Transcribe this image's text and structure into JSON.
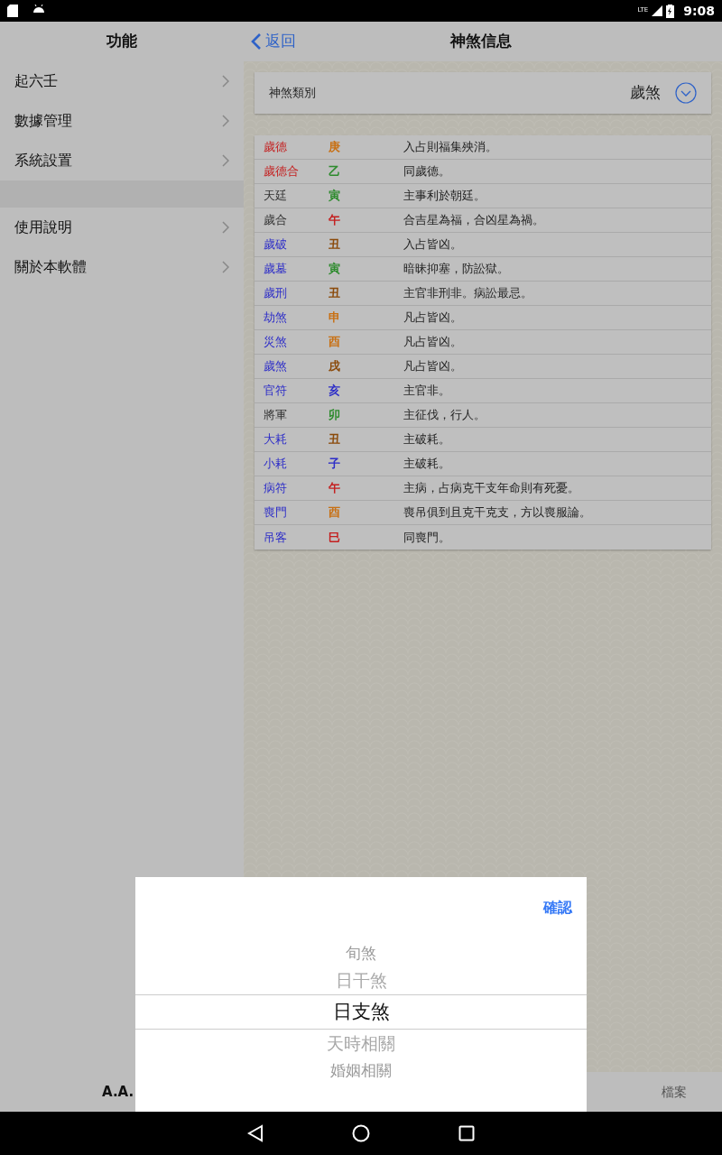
{
  "status_bar": {
    "time": "9:08",
    "network": "LTE"
  },
  "sidebar": {
    "title": "功能",
    "items": [
      {
        "label": "起六壬",
        "kind": "link"
      },
      {
        "label": "數據管理",
        "kind": "link"
      },
      {
        "label": "系統設置",
        "kind": "link"
      },
      {
        "kind": "spacer"
      },
      {
        "label": "使用說明",
        "kind": "link"
      },
      {
        "label": "關於本軟體",
        "kind": "link"
      }
    ]
  },
  "header": {
    "back": "返回",
    "title": "神煞信息"
  },
  "category": {
    "label": "神煞類別",
    "value": "歲煞"
  },
  "table": {
    "rows": [
      {
        "name": {
          "text": "歲德",
          "color": "#c41f1f"
        },
        "branch": {
          "text": "庚",
          "color": "#c87014"
        },
        "meaning": "入占則福集殃消。"
      },
      {
        "name": {
          "text": "歲德合",
          "color": "#c41f1f"
        },
        "branch": {
          "text": "乙",
          "color": "#2e8b2e"
        },
        "meaning": "同歲德。"
      },
      {
        "name": {
          "text": "天廷",
          "color": "#333333"
        },
        "branch": {
          "text": "寅",
          "color": "#2e8b2e"
        },
        "meaning": "主事利於朝廷。"
      },
      {
        "name": {
          "text": "歲合",
          "color": "#333333"
        },
        "branch": {
          "text": "午",
          "color": "#c41f1f"
        },
        "meaning": "合吉星為福，合凶星為禍。"
      },
      {
        "name": {
          "text": "歲破",
          "color": "#2c2cc8"
        },
        "branch": {
          "text": "丑",
          "color": "#8b4a0a"
        },
        "meaning": "入占皆凶。"
      },
      {
        "name": {
          "text": "歲墓",
          "color": "#2c2cc8"
        },
        "branch": {
          "text": "寅",
          "color": "#2e8b2e"
        },
        "meaning": "暗昧抑塞，防訟獄。"
      },
      {
        "name": {
          "text": "歲刑",
          "color": "#2c2cc8"
        },
        "branch": {
          "text": "丑",
          "color": "#8b4a0a"
        },
        "meaning": "主官非刑非。病訟最忌。"
      },
      {
        "name": {
          "text": "劫煞",
          "color": "#2c2cc8"
        },
        "branch": {
          "text": "申",
          "color": "#c87014"
        },
        "meaning": "凡占皆凶。"
      },
      {
        "name": {
          "text": "災煞",
          "color": "#2c2cc8"
        },
        "branch": {
          "text": "酉",
          "color": "#c87014"
        },
        "meaning": "凡占皆凶。"
      },
      {
        "name": {
          "text": "歲煞",
          "color": "#2c2cc8"
        },
        "branch": {
          "text": "戌",
          "color": "#8b4a0a"
        },
        "meaning": "凡占皆凶。"
      },
      {
        "name": {
          "text": "官符",
          "color": "#2c2cc8"
        },
        "branch": {
          "text": "亥",
          "color": "#2c2cc8"
        },
        "meaning": "主官非。"
      },
      {
        "name": {
          "text": "將軍",
          "color": "#333333"
        },
        "branch": {
          "text": "卯",
          "color": "#2e8b2e"
        },
        "meaning": "主征伐，行人。"
      },
      {
        "name": {
          "text": "大耗",
          "color": "#2c2cc8"
        },
        "branch": {
          "text": "丑",
          "color": "#8b4a0a"
        },
        "meaning": "主破耗。"
      },
      {
        "name": {
          "text": "小耗",
          "color": "#2c2cc8"
        },
        "branch": {
          "text": "子",
          "color": "#2c2cc8"
        },
        "meaning": "主破耗。"
      },
      {
        "name": {
          "text": "病符",
          "color": "#2c2cc8"
        },
        "branch": {
          "text": "午",
          "color": "#c41f1f"
        },
        "meaning": "主病，占病克干支年命則有死憂。"
      },
      {
        "name": {
          "text": "喪門",
          "color": "#2c2cc8"
        },
        "branch": {
          "text": "酉",
          "color": "#c87014"
        },
        "meaning": "喪吊俱到且克干克支，方以喪服論。"
      },
      {
        "name": {
          "text": "吊客",
          "color": "#2c2cc8"
        },
        "branch": {
          "text": "巳",
          "color": "#c41f1f"
        },
        "meaning": "同喪門。"
      }
    ]
  },
  "tab_bar": {
    "tabs": [
      "A.A.",
      "檔案"
    ]
  },
  "picker": {
    "confirm": "確認",
    "options": [
      {
        "label": "旬煞",
        "selected": false
      },
      {
        "label": "日干煞",
        "selected": false
      },
      {
        "label": "日支煞",
        "selected": true
      },
      {
        "label": "天時相關",
        "selected": false
      },
      {
        "label": "婚姻相關",
        "selected": false
      }
    ]
  }
}
